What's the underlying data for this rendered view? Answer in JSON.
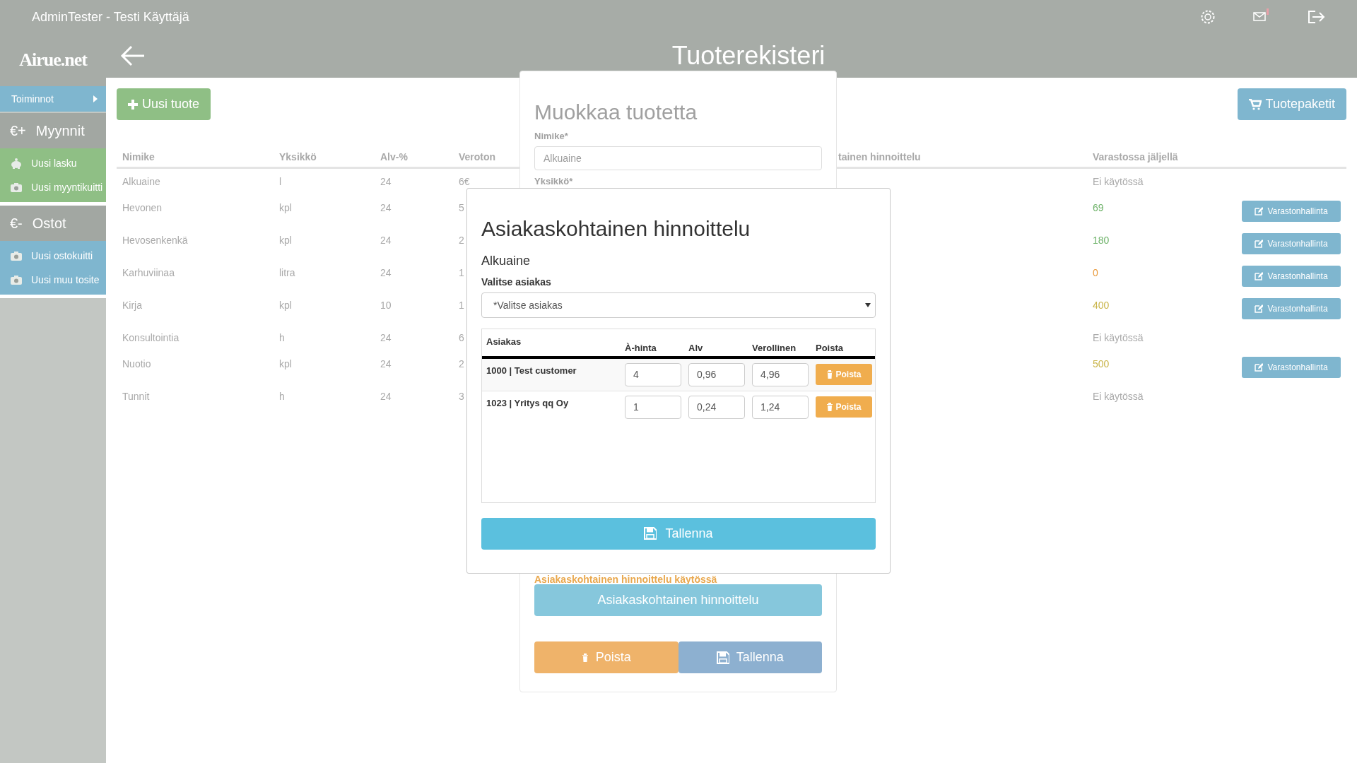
{
  "top_bar": {
    "user": "AdminTester - Testi Käyttäjä"
  },
  "sidebar": {
    "logo": "Airue.net",
    "menu_toggle": "Toiminnot",
    "sections": [
      {
        "icon": "€+",
        "title": "Myynnit",
        "kind": "sales",
        "items": [
          {
            "label": "Uusi lasku",
            "kind": "invoice"
          },
          {
            "label": "Uusi myyntikuitti",
            "kind": "receipt"
          }
        ]
      },
      {
        "icon": "€-",
        "title": "Ostot",
        "kind": "purchases",
        "items": [
          {
            "label": "Uusi ostokuitti",
            "kind": "receipt"
          },
          {
            "label": "Uusi muu tosite",
            "kind": "receipt"
          }
        ]
      }
    ]
  },
  "page": {
    "title": "Tuoterekisteri",
    "new_button": "Uusi tuote",
    "packages_button": "Tuotepaketit"
  },
  "table": {
    "columns": [
      "Nimike",
      "Yksikkö",
      "Alv-%",
      "Veroton",
      "tainen hinnoittelu",
      "Varastossa jäljellä"
    ],
    "rows": [
      {
        "name": "Alkuaine",
        "unit": "l",
        "vat": "24",
        "net": "6€",
        "stock": {
          "text": "Ei käytössä",
          "color": "#a9a9a9"
        }
      },
      {
        "name": "Hevonen",
        "unit": "kpl",
        "vat": "24",
        "net": "5",
        "stock": {
          "text": "69",
          "color": "#6fb36a"
        },
        "button": "Varastonhallinta"
      },
      {
        "name": "Hevosenkenkä",
        "unit": "kpl",
        "vat": "24",
        "net": "2",
        "stock": {
          "text": "180",
          "color": "#6fb36a"
        },
        "button": "Varastonhallinta"
      },
      {
        "name": "Karhuviinaa",
        "unit": "litra",
        "vat": "24",
        "net": "1",
        "stock": {
          "text": "0",
          "color": "#e99a3c"
        },
        "button": "Varastonhallinta"
      },
      {
        "name": "Kirja",
        "unit": "kpl",
        "vat": "10",
        "net": "1",
        "stock": {
          "text": "400",
          "color": "#c9b448"
        },
        "button": "Varastonhallinta"
      },
      {
        "name": "Konsultointia",
        "unit": "h",
        "vat": "24",
        "net": "6",
        "stock": {
          "text": "Ei käytössä",
          "color": "#a9a9a9"
        }
      },
      {
        "name": "Nuotio",
        "unit": "kpl",
        "vat": "24",
        "net": "2",
        "stock": {
          "text": "500",
          "color": "#c9b448"
        },
        "button": "Varastonhallinta"
      },
      {
        "name": "Tunnit",
        "unit": "h",
        "vat": "24",
        "net": "3",
        "stock": {
          "text": "Ei käytössä",
          "color": "#a9a9a9"
        }
      }
    ]
  },
  "edit_panel": {
    "title": "Muokkaa tuotetta",
    "fields": [
      {
        "label": "Nimike*",
        "value": "Alkuaine"
      },
      {
        "label": "Yksikkö*"
      }
    ],
    "pricing_note": "Asiakaskohtainen hinnoittelu käytössä",
    "pricing_button": "Asiakaskohtainen hinnoittelu",
    "delete_button": "Poista",
    "save_button": "Tallenna"
  },
  "modal": {
    "title": "Asiakaskohtainen hinnoittelu",
    "product": "Alkuaine",
    "select_label": "Valitse asiakas",
    "select_value": "*Valitse asiakas",
    "columns": [
      "Asiakas",
      "À-hinta",
      "Alv",
      "Verollinen",
      "Poista"
    ],
    "rows": [
      {
        "customer": "1000 | Test customer",
        "unit_price": "4",
        "vat": "0,96",
        "gross": "4,96",
        "delete": "Poista"
      },
      {
        "customer": "1023 | Yritys qq Oy",
        "unit_price": "1",
        "vat": "0,24",
        "gross": "1,24",
        "delete": "Poista"
      }
    ],
    "save_button": "Tallenna"
  }
}
